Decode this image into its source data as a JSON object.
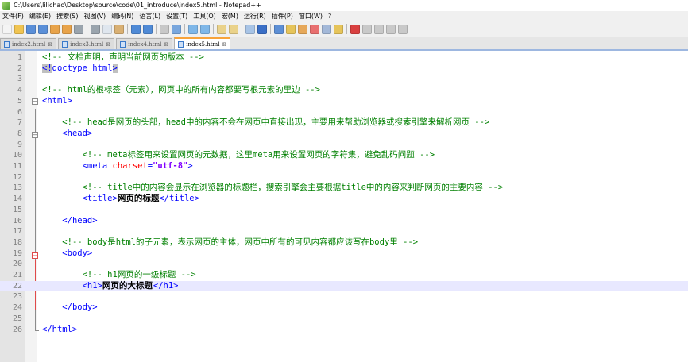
{
  "window": {
    "title": "C:\\Users\\lilichao\\Desktop\\source\\code\\01_introduce\\index5.html - Notepad++"
  },
  "menu": [
    "文件(F)",
    "编辑(E)",
    "搜索(S)",
    "视图(V)",
    "编码(N)",
    "语言(L)",
    "设置(T)",
    "工具(O)",
    "宏(M)",
    "运行(R)",
    "插件(P)",
    "窗口(W)",
    "?"
  ],
  "toolbar": {
    "buttons": [
      {
        "icon": "new-file-icon",
        "color": "#f4f4f4"
      },
      {
        "icon": "open-file-icon",
        "color": "#f0c451"
      },
      {
        "icon": "save-icon",
        "color": "#5a8fd8"
      },
      {
        "icon": "save-all-icon",
        "color": "#5a8fd8"
      },
      {
        "icon": "close-icon",
        "color": "#e8a34a"
      },
      {
        "icon": "close-all-icon",
        "color": "#e8a34a"
      },
      {
        "icon": "print-icon",
        "color": "#9aa4ad"
      },
      {
        "sep": true
      },
      {
        "icon": "cut-icon",
        "color": "#9aa4ad"
      },
      {
        "icon": "copy-icon",
        "color": "#dfe6ee"
      },
      {
        "icon": "paste-icon",
        "color": "#d9b073"
      },
      {
        "sep": true
      },
      {
        "icon": "undo-icon",
        "color": "#4f8ad6"
      },
      {
        "icon": "redo-icon",
        "color": "#4f8ad6"
      },
      {
        "sep": true
      },
      {
        "icon": "find-icon",
        "color": "#c8c8c8"
      },
      {
        "icon": "replace-icon",
        "color": "#7aa7dd"
      },
      {
        "sep": true
      },
      {
        "icon": "zoom-in-icon",
        "color": "#7fb7e8"
      },
      {
        "icon": "zoom-out-icon",
        "color": "#7fb7e8"
      },
      {
        "sep": true
      },
      {
        "icon": "sync-v-icon",
        "color": "#ead28a"
      },
      {
        "icon": "sync-h-icon",
        "color": "#ead28a"
      },
      {
        "sep": true
      },
      {
        "icon": "word-wrap-icon",
        "color": "#a8c4e6"
      },
      {
        "icon": "show-all-chars-icon",
        "color": "#3b6fc6"
      },
      {
        "sep": true
      },
      {
        "icon": "indent-guide-icon",
        "color": "#5d8fd5"
      },
      {
        "icon": "udl-icon",
        "color": "#e6c45a"
      },
      {
        "icon": "doc-map-icon",
        "color": "#e6a85a"
      },
      {
        "icon": "function-list-icon",
        "color": "#e86f6f"
      },
      {
        "icon": "folder-workspace-icon",
        "color": "#a3b8d8"
      },
      {
        "icon": "monitoring-icon",
        "color": "#e6c45a"
      },
      {
        "sep": true
      },
      {
        "icon": "record-macro-icon",
        "color": "#d94040"
      },
      {
        "icon": "stop-record-icon",
        "color": "#c9c9c9"
      },
      {
        "icon": "play-macro-icon",
        "color": "#c9c9c9"
      },
      {
        "icon": "play-multiple-icon",
        "color": "#c9c9c9"
      },
      {
        "icon": "save-macro-icon",
        "color": "#c9c9c9"
      }
    ]
  },
  "tabs": [
    {
      "label": "index2.html",
      "active": false
    },
    {
      "label": "index3.html",
      "active": false
    },
    {
      "label": "index4.html",
      "active": false
    },
    {
      "label": "index5.html",
      "active": true
    }
  ],
  "editor": {
    "current_line": 22,
    "lines": [
      {
        "n": "1",
        "indent": "",
        "parts": [
          [
            "comment",
            "<!-- 文档声明，声明当前网页的版本 -->"
          ]
        ]
      },
      {
        "n": "2",
        "indent": "",
        "parts": [
          [
            "tag-sel",
            "<!"
          ],
          [
            "tag",
            "doctype html"
          ],
          [
            "tag-sel",
            ">"
          ]
        ]
      },
      {
        "n": "3",
        "indent": "",
        "parts": []
      },
      {
        "n": "4",
        "indent": "",
        "parts": [
          [
            "comment",
            "<!-- html的根标签（元素），网页中的所有内容都要写根元素的里边 -->"
          ]
        ]
      },
      {
        "n": "5",
        "indent": "",
        "parts": [
          [
            "tag",
            "<html>"
          ]
        ]
      },
      {
        "n": "6",
        "indent": "",
        "parts": []
      },
      {
        "n": "7",
        "indent": "    ",
        "parts": [
          [
            "comment",
            "<!-- head是网页的头部，head中的内容不会在网页中直接出现，主要用来帮助浏览器或搜索引擎来解析网页 -->"
          ]
        ]
      },
      {
        "n": "8",
        "indent": "    ",
        "parts": [
          [
            "tag",
            "<head>"
          ]
        ]
      },
      {
        "n": "9",
        "indent": "",
        "parts": []
      },
      {
        "n": "10",
        "indent": "        ",
        "parts": [
          [
            "comment",
            "<!-- meta标签用来设置网页的元数据，这里meta用来设置网页的字符集，避免乱码问题 -->"
          ]
        ]
      },
      {
        "n": "11",
        "indent": "        ",
        "parts": [
          [
            "tag",
            "<meta "
          ],
          [
            "attr",
            "charset"
          ],
          [
            "tag",
            "="
          ],
          [
            "val",
            "\"utf-8\""
          ],
          [
            "tag",
            ">"
          ]
        ]
      },
      {
        "n": "12",
        "indent": "",
        "parts": []
      },
      {
        "n": "13",
        "indent": "        ",
        "parts": [
          [
            "comment",
            "<!-- title中的内容会显示在浏览器的标题栏，搜索引擎会主要根据title中的内容来判断网页的主要内容 -->"
          ]
        ]
      },
      {
        "n": "14",
        "indent": "        ",
        "parts": [
          [
            "tag",
            "<title>"
          ],
          [
            "text",
            "网页的标题"
          ],
          [
            "tag",
            "</title>"
          ]
        ]
      },
      {
        "n": "15",
        "indent": "",
        "parts": []
      },
      {
        "n": "16",
        "indent": "    ",
        "parts": [
          [
            "tag",
            "</head>"
          ]
        ]
      },
      {
        "n": "17",
        "indent": "",
        "parts": []
      },
      {
        "n": "18",
        "indent": "    ",
        "parts": [
          [
            "comment",
            "<!-- body是html的子元素，表示网页的主体，网页中所有的可见内容都应该写在body里 -->"
          ]
        ]
      },
      {
        "n": "19",
        "indent": "    ",
        "parts": [
          [
            "tag",
            "<body>"
          ]
        ]
      },
      {
        "n": "20",
        "indent": "",
        "parts": []
      },
      {
        "n": "21",
        "indent": "        ",
        "parts": [
          [
            "comment",
            "<!-- h1网页的一级标题 -->"
          ]
        ]
      },
      {
        "n": "22",
        "indent": "        ",
        "parts": [
          [
            "tag",
            "<h1>"
          ],
          [
            "text",
            "网页的大标题"
          ],
          [
            "caret",
            ""
          ],
          [
            "tag",
            "</h1>"
          ]
        ]
      },
      {
        "n": "23",
        "indent": "",
        "parts": []
      },
      {
        "n": "24",
        "indent": "    ",
        "parts": [
          [
            "tag",
            "</body>"
          ]
        ]
      },
      {
        "n": "25",
        "indent": "",
        "parts": []
      },
      {
        "n": "26",
        "indent": "",
        "parts": [
          [
            "tag",
            "</html>"
          ]
        ]
      }
    ]
  }
}
